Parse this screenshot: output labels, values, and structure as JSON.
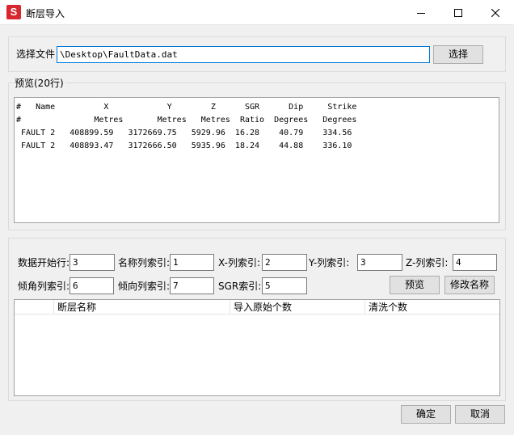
{
  "window": {
    "title": "断层导入",
    "icon_glyph": "S",
    "icon_color": "#d8272e"
  },
  "file": {
    "label": "选择文件",
    "path": "\\Desktop\\FaultData.dat",
    "browse_label": "选择"
  },
  "preview": {
    "group_title": "预览(20行)",
    "lines": [
      "#   Name          X            Y        Z      SGR      Dip     Strike",
      "#               Metres       Metres   Metres  Ratio  Degrees   Degrees",
      " FAULT 2   408899.59   3172669.75   5929.96  16.28    40.79    334.56",
      " FAULT 2   408893.47   3172666.50   5935.96  18.24    44.88    336.10"
    ]
  },
  "params": {
    "start_row_label": "数据开始行:",
    "start_row_value": "3",
    "name_col_label": "名称列索引:",
    "name_col_value": "1",
    "x_col_label": "X-列索引:",
    "x_col_value": "2",
    "y_col_label": "Y-列索引:",
    "y_col_value": "3",
    "z_col_label": "Z-列索引:",
    "z_col_value": "4",
    "dip_col_label": "倾角列索引:",
    "dip_col_value": "6",
    "strike_col_label": "倾向列索引:",
    "strike_col_value": "7",
    "sgr_col_label": "SGR索引:",
    "sgr_col_value": "5",
    "preview_button": "预览",
    "rename_button": "修改名称"
  },
  "fault_table": {
    "columns": [
      "",
      "断层名称",
      "导入原始个数",
      "清洗个数"
    ]
  },
  "footer": {
    "ok_label": "确定",
    "cancel_label": "取消"
  }
}
